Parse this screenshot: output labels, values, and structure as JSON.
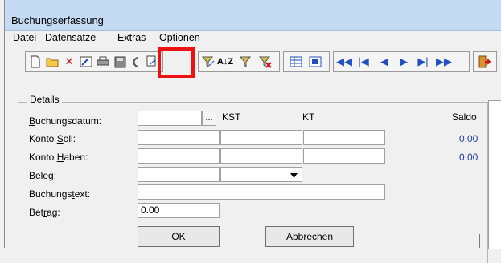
{
  "window": {
    "title": "Buchungserfassung"
  },
  "menu": [
    "Datei",
    "Datensätze",
    "Extras",
    "Optionen"
  ],
  "toolbar": {
    "buttons": [
      "new-icon",
      "open-icon",
      "delete-icon",
      "edit-icon",
      "print-icon",
      "save-icon",
      "refresh-icon",
      "copy-icon",
      "filter-edit-icon",
      "sort-icon",
      "filter-icon",
      "filter-remove-icon",
      "grid-view-icon",
      "form-view-icon",
      "first-record-icon",
      "prev-page-icon",
      "prev-icon",
      "next-icon",
      "next-page-icon",
      "last-record-icon",
      "exit-icon"
    ]
  },
  "details": {
    "title": "Details",
    "col_kst": "KST",
    "col_kt": "KT",
    "col_saldo": "Saldo",
    "buchungsdatum_label": "Buchungsdatum:",
    "ellipsis": "...",
    "konto_soll_label": "Konto Soll:",
    "konto_haben_label": "Konto Haben:",
    "beleg_label": "Beleg:",
    "buchungstext_label": "Buchungstext:",
    "betrag_label": "Betrag:",
    "betrag_value": "0.00",
    "saldo_soll": "0.00",
    "saldo_haben": "0.00"
  },
  "buttons": {
    "ok": "OK",
    "abbrechen": "Abbrechen"
  },
  "colors": {
    "highlight": "#ec1212",
    "saldo": "#1f3fb0",
    "titlebar": "#c4dbf3"
  }
}
